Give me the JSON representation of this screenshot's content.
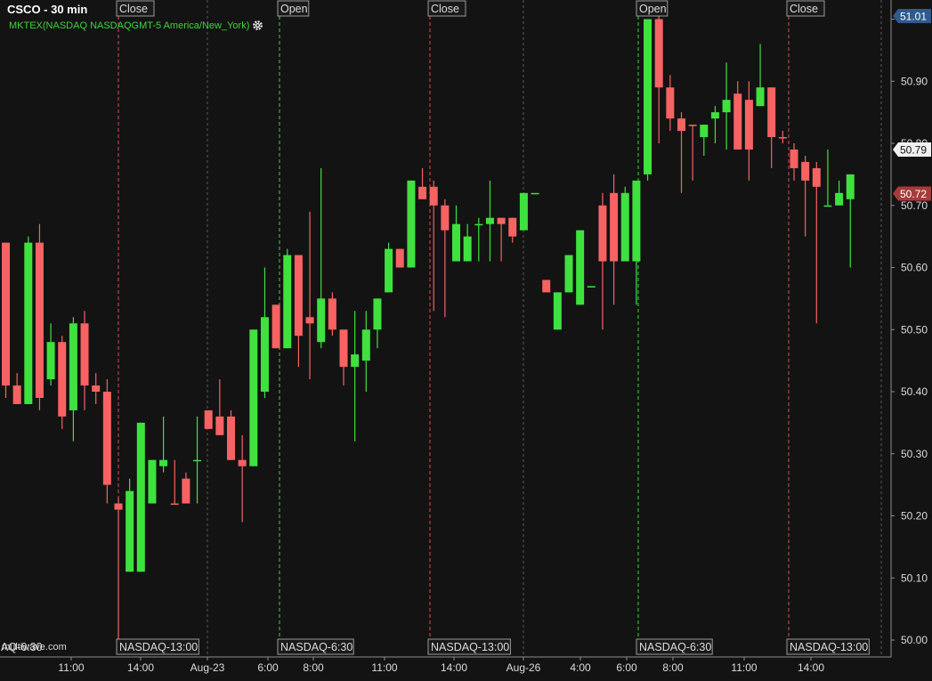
{
  "header": {
    "symbol_title": "CSCO - 30 min",
    "study_label": "MKTEX(NASDAQ NASDAQGMT-5 America/New_York)",
    "settings_icon": "gear-icon"
  },
  "watermark": "multiwave.com",
  "bottom_left_marker": "AQ-6:30",
  "colors": {
    "background": "#131313",
    "up": "#3fe13f",
    "down": "#f76363",
    "axis_text": "#dcdcdc",
    "last_price_badge": "#2e5a8c",
    "prior_close_badge": "#a83a3a",
    "open_line": "#3bd63b",
    "close_line": "#d94c4c"
  },
  "chart_data": {
    "type": "candlestick",
    "title": "CSCO - 30 min",
    "y_range": [
      50.0,
      51.02
    ],
    "y_ticks": [
      "50.00",
      "50.10",
      "50.20",
      "50.30",
      "50.40",
      "50.50",
      "50.60",
      "50.70",
      "50.80",
      "50.90",
      "51.00"
    ],
    "x_ticks": [
      "11:00",
      "14:00",
      "Aug-23",
      "6:00",
      "8:00",
      "11:00",
      "14:00",
      "Aug-26",
      "4:00",
      "6:00",
      "8:00",
      "11:00",
      "14:00"
    ],
    "price_badges": [
      {
        "label": "51.01",
        "value": 51.005,
        "kind": "last"
      },
      {
        "label": "50.79",
        "value": 50.79,
        "kind": "current"
      },
      {
        "label": "50.72",
        "value": 50.719,
        "kind": "prior"
      }
    ],
    "session_markers": [
      {
        "top_label": "Close",
        "bottom_label": "NASDAQ-13:00",
        "kind": "close"
      },
      {
        "top_label": "Open",
        "bottom_label": "NASDAQ-6:30",
        "kind": "open"
      },
      {
        "top_label": "Close",
        "bottom_label": "NASDAQ-13:00",
        "kind": "close"
      },
      {
        "top_label": "Open",
        "bottom_label": "NASDAQ-6:30",
        "kind": "open"
      },
      {
        "top_label": "Close",
        "bottom_label": "NASDAQ-13:00",
        "kind": "close"
      }
    ],
    "candles": [
      [
        50.64,
        50.41,
        50.64,
        50.39,
        "d"
      ],
      [
        50.41,
        50.38,
        50.43,
        50.38,
        "d"
      ],
      [
        50.38,
        50.64,
        50.65,
        50.38,
        "u"
      ],
      [
        50.64,
        50.39,
        50.67,
        50.37,
        "d"
      ],
      [
        50.42,
        50.48,
        50.51,
        50.41,
        "u"
      ],
      [
        50.48,
        50.36,
        50.49,
        50.34,
        "d"
      ],
      [
        50.37,
        50.51,
        50.52,
        50.32,
        "u"
      ],
      [
        50.51,
        50.41,
        50.53,
        50.37,
        "d"
      ],
      [
        50.41,
        50.4,
        50.43,
        50.38,
        "d"
      ],
      [
        50.4,
        50.25,
        50.42,
        50.22,
        "d"
      ],
      [
        50.22,
        50.21,
        50.23,
        50.0,
        "d"
      ],
      [
        50.11,
        50.24,
        50.26,
        50.11,
        "u"
      ],
      [
        50.11,
        50.35,
        50.35,
        50.11,
        "u"
      ],
      [
        50.22,
        50.29,
        50.29,
        50.22,
        "u"
      ],
      [
        50.28,
        50.29,
        50.36,
        50.27,
        "u"
      ],
      [
        50.22,
        50.22,
        50.29,
        50.22,
        "d"
      ],
      [
        50.26,
        50.22,
        50.27,
        50.22,
        "d"
      ],
      [
        50.29,
        50.29,
        50.36,
        50.22,
        "u"
      ],
      [
        50.37,
        50.34,
        50.37,
        50.34,
        "d"
      ],
      [
        50.36,
        50.33,
        50.42,
        50.33,
        "d"
      ],
      [
        50.36,
        50.29,
        50.37,
        50.29,
        "d"
      ],
      [
        50.29,
        50.28,
        50.33,
        50.19,
        "d"
      ],
      [
        50.28,
        50.5,
        50.5,
        50.28,
        "u"
      ],
      [
        50.4,
        50.52,
        50.6,
        50.39,
        "u"
      ],
      [
        50.54,
        50.47,
        50.54,
        50.47,
        "d"
      ],
      [
        50.47,
        50.62,
        50.63,
        50.47,
        "u"
      ],
      [
        50.62,
        50.49,
        50.62,
        50.44,
        "d"
      ],
      [
        50.52,
        50.51,
        50.69,
        50.42,
        "d"
      ],
      [
        50.48,
        50.55,
        50.76,
        50.47,
        "u"
      ],
      [
        50.55,
        50.5,
        50.56,
        50.49,
        "d"
      ],
      [
        50.5,
        50.44,
        50.5,
        50.41,
        "d"
      ],
      [
        50.44,
        50.46,
        50.53,
        50.32,
        "u"
      ],
      [
        50.45,
        50.5,
        50.53,
        50.4,
        "u"
      ],
      [
        50.5,
        50.55,
        50.55,
        50.47,
        "u"
      ],
      [
        50.56,
        50.63,
        50.64,
        50.56,
        "u"
      ],
      [
        50.63,
        50.6,
        50.63,
        50.6,
        "d"
      ],
      [
        50.6,
        50.74,
        50.74,
        50.6,
        "u"
      ],
      [
        50.73,
        50.71,
        50.76,
        50.71,
        "d"
      ],
      [
        50.73,
        50.7,
        50.74,
        50.53,
        "d"
      ],
      [
        50.7,
        50.66,
        50.71,
        50.52,
        "d"
      ],
      [
        50.61,
        50.67,
        50.7,
        50.61,
        "u"
      ],
      [
        50.61,
        50.65,
        50.67,
        50.61,
        "u"
      ],
      [
        50.67,
        50.67,
        50.68,
        50.61,
        "u"
      ],
      [
        50.67,
        50.68,
        50.74,
        50.61,
        "u"
      ],
      [
        50.68,
        50.67,
        50.68,
        50.61,
        "d"
      ],
      [
        50.68,
        50.65,
        50.68,
        50.64,
        "d"
      ],
      [
        50.66,
        50.72,
        50.72,
        50.66,
        "u"
      ],
      [
        50.72,
        50.72,
        50.72,
        50.72,
        "u"
      ],
      [
        50.58,
        50.56,
        50.58,
        50.56,
        "d"
      ],
      [
        50.5,
        50.56,
        50.56,
        50.5,
        "u"
      ],
      [
        50.56,
        50.62,
        50.62,
        50.56,
        "u"
      ],
      [
        50.54,
        50.66,
        50.66,
        50.54,
        "u"
      ],
      [
        50.57,
        50.57,
        50.57,
        50.57,
        "u"
      ],
      [
        50.7,
        50.61,
        50.72,
        50.5,
        "d"
      ],
      [
        50.72,
        50.61,
        50.75,
        50.54,
        "d"
      ],
      [
        50.61,
        50.72,
        50.73,
        50.61,
        "u"
      ],
      [
        50.61,
        50.74,
        50.73,
        50.54,
        "u"
      ],
      [
        50.75,
        51.0,
        51.0,
        50.74,
        "u"
      ],
      [
        51.0,
        50.89,
        51.01,
        50.8,
        "d"
      ],
      [
        50.89,
        50.84,
        50.91,
        50.82,
        "d"
      ],
      [
        50.84,
        50.82,
        50.85,
        50.72,
        "d"
      ],
      [
        50.83,
        50.83,
        50.83,
        50.74,
        "d"
      ],
      [
        50.81,
        50.83,
        50.83,
        50.78,
        "u"
      ],
      [
        50.84,
        50.85,
        50.86,
        50.8,
        "u"
      ],
      [
        50.85,
        50.87,
        50.93,
        50.79,
        "u"
      ],
      [
        50.88,
        50.79,
        50.9,
        50.79,
        "d"
      ],
      [
        50.87,
        50.79,
        50.9,
        50.74,
        "d"
      ],
      [
        50.86,
        50.89,
        50.96,
        50.86,
        "u"
      ],
      [
        50.89,
        50.81,
        50.89,
        50.76,
        "d"
      ],
      [
        50.81,
        50.81,
        50.82,
        50.8,
        "d"
      ],
      [
        50.79,
        50.76,
        50.8,
        50.74,
        "d"
      ],
      [
        50.77,
        50.74,
        50.78,
        50.65,
        "d"
      ],
      [
        50.76,
        50.73,
        50.77,
        50.51,
        "d"
      ],
      [
        50.7,
        50.7,
        50.79,
        50.7,
        "u"
      ],
      [
        50.7,
        50.72,
        50.74,
        50.7,
        "u"
      ],
      [
        50.71,
        50.75,
        50.75,
        50.6,
        "u"
      ]
    ]
  }
}
